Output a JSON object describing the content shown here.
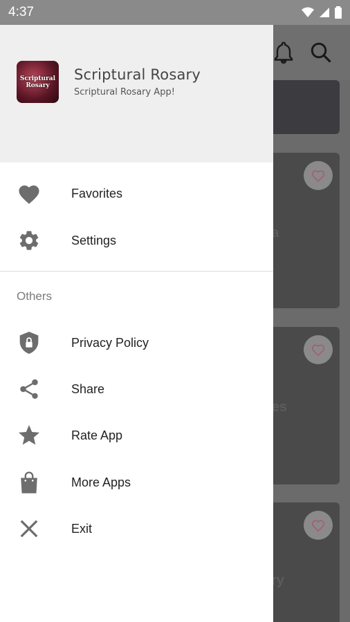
{
  "status_bar": {
    "time": "4:37"
  },
  "drawer": {
    "header": {
      "app_name": "Scriptural Rosary",
      "app_subtitle": "Scriptural Rosary App!",
      "logo_text": "Scriptural Rosary"
    },
    "primary_items": [
      {
        "label": "Favorites",
        "icon": "heart-icon"
      },
      {
        "label": "Settings",
        "icon": "gear-icon"
      }
    ],
    "section_title": "Others",
    "other_items": [
      {
        "label": "Privacy Policy",
        "icon": "shield-lock-icon"
      },
      {
        "label": "Share",
        "icon": "share-icon"
      },
      {
        "label": "Rate App",
        "icon": "star-icon"
      },
      {
        "label": "More Apps",
        "icon": "shopping-bag-icon"
      },
      {
        "label": "Exit",
        "icon": "close-icon"
      }
    ]
  },
  "background": {
    "card_captions": [
      "da",
      "res",
      "ry"
    ]
  },
  "colors": {
    "icon_gray": "#6d6d6d",
    "header_bg": "#efefef"
  }
}
